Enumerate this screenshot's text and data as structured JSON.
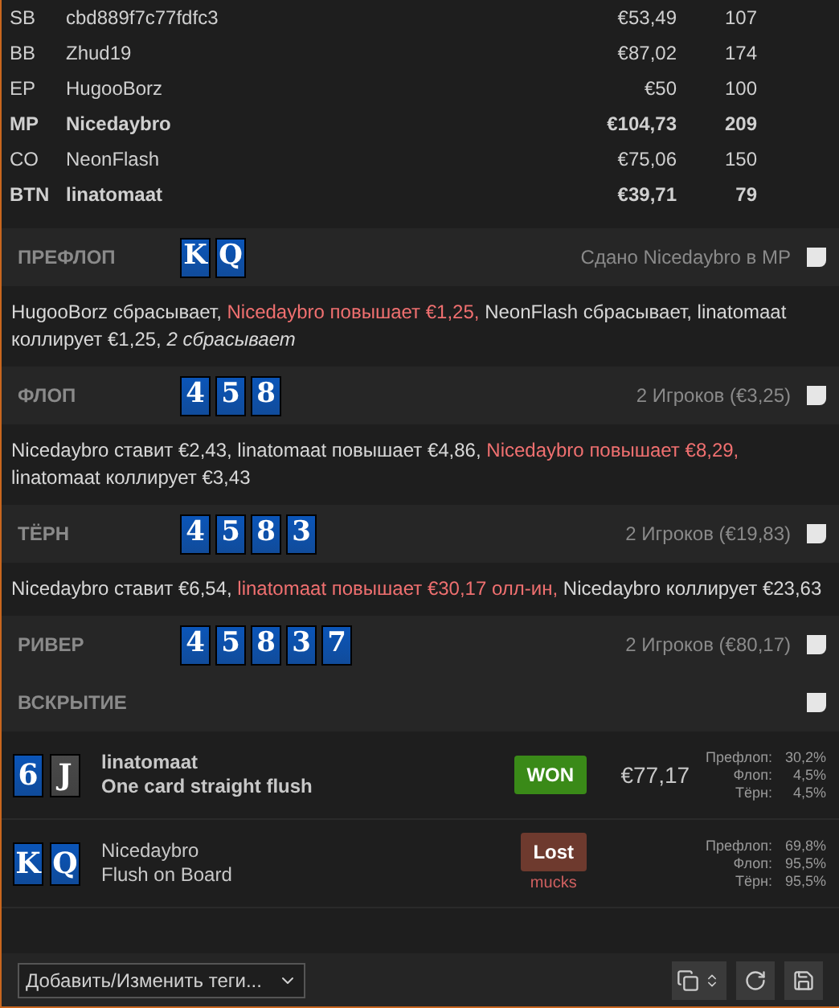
{
  "players": [
    {
      "position": "SB",
      "name": "cbd889f7c77fdfc3",
      "stack": "€53,49",
      "bb": "107",
      "bold": false
    },
    {
      "position": "BB",
      "name": "Zhud19",
      "stack": "€87,02",
      "bb": "174",
      "bold": false
    },
    {
      "position": "EP",
      "name": "HugooBorz",
      "stack": "€50",
      "bb": "100",
      "bold": false
    },
    {
      "position": "MP",
      "name": "Nicedaybro",
      "stack": "€104,73",
      "bb": "209",
      "bold": true
    },
    {
      "position": "CO",
      "name": "NeonFlash",
      "stack": "€75,06",
      "bb": "150",
      "bold": false
    },
    {
      "position": "BTN",
      "name": "linatomaat",
      "stack": "€39,71",
      "bb": "79",
      "bold": true
    }
  ],
  "streets": [
    {
      "title": "ПРЕФЛОП",
      "cards": [
        {
          "rank": "K",
          "color": "#0b55b8"
        },
        {
          "rank": "Q",
          "color": "#0b55b8"
        }
      ],
      "info": "Сдано Nicedaybro в MP",
      "actions": [
        {
          "text": "HugooBorz сбрасывает, ",
          "kind": "normal"
        },
        {
          "text": "Nicedaybro повышает €1,25,",
          "kind": "raise"
        },
        {
          "text": " NeonFlash сбрасывает, linatomaat коллирует €1,25, ",
          "kind": "normal"
        },
        {
          "text": "2 сбрасывает",
          "kind": "summary"
        }
      ]
    },
    {
      "title": "ФЛОП",
      "cards": [
        {
          "rank": "4",
          "color": "#0b55b8"
        },
        {
          "rank": "5",
          "color": "#0b55b8"
        },
        {
          "rank": "8",
          "color": "#0b55b8"
        }
      ],
      "info": "2 Игроков (€3,25)",
      "actions": [
        {
          "text": "Nicedaybro ставит €2,43, linatomaat повышает €4,86, ",
          "kind": "normal"
        },
        {
          "text": "Nicedaybro повышает €8,29,",
          "kind": "raise"
        },
        {
          "text": " linatomaat коллирует €3,43",
          "kind": "normal"
        }
      ]
    },
    {
      "title": "ТЁРН",
      "cards": [
        {
          "rank": "4",
          "color": "#0b55b8"
        },
        {
          "rank": "5",
          "color": "#0b55b8"
        },
        {
          "rank": "8",
          "color": "#0b55b8"
        },
        {
          "rank": "3",
          "color": "#0b55b8"
        }
      ],
      "info": "2 Игроков (€19,83)",
      "actions": [
        {
          "text": "Nicedaybro ставит €6,54, ",
          "kind": "normal"
        },
        {
          "text": "linatomaat повышает €30,17 олл-ин,",
          "kind": "raise"
        },
        {
          "text": " Nicedaybro коллирует €23,63",
          "kind": "normal"
        }
      ]
    },
    {
      "title": "РИВЕР",
      "cards": [
        {
          "rank": "4",
          "color": "#0b55b8"
        },
        {
          "rank": "5",
          "color": "#0b55b8"
        },
        {
          "rank": "8",
          "color": "#0b55b8"
        },
        {
          "rank": "3",
          "color": "#0b55b8"
        },
        {
          "rank": "7",
          "color": "#0b55b8"
        }
      ],
      "info": "2 Игроков (€80,17)"
    },
    {
      "title": "ВСКРЫТИЕ"
    }
  ],
  "showdown": [
    {
      "cards": [
        {
          "rank": "6",
          "color": "#0b55b8"
        },
        {
          "rank": "J",
          "color": "#4a4a4a"
        }
      ],
      "name": "linatomaat",
      "hand": "One card straight flush",
      "winner": true,
      "result": {
        "kind": "won",
        "label": "WON"
      },
      "amount": "€77,17",
      "equity": [
        {
          "label": "Префлоп:",
          "value": "30,2%"
        },
        {
          "label": "Флоп:",
          "value": "4,5%"
        },
        {
          "label": "Тёрн:",
          "value": "4,5%"
        }
      ]
    },
    {
      "cards": [
        {
          "rank": "K",
          "color": "#0b55b8"
        },
        {
          "rank": "Q",
          "color": "#0b55b8"
        }
      ],
      "name": "Nicedaybro",
      "hand": "Flush on Board",
      "winner": false,
      "result": {
        "kind": "lost",
        "label": "Lost"
      },
      "note": "mucks",
      "equity": [
        {
          "label": "Префлоп:",
          "value": "69,8%"
        },
        {
          "label": "Флоп:",
          "value": "95,5%"
        },
        {
          "label": "Тёрн:",
          "value": "95,5%"
        }
      ]
    }
  ],
  "tags_dropdown": {
    "value": "Добавить/Изменить теги..."
  }
}
